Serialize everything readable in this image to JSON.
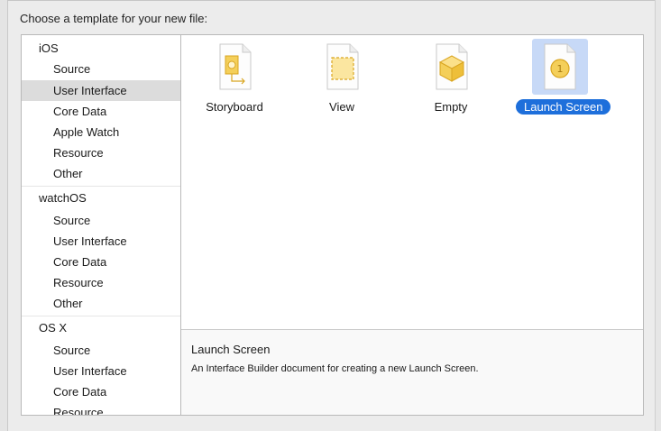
{
  "dialog": {
    "header": "Choose a template for your new file:"
  },
  "sidebar": {
    "items": [
      {
        "label": "iOS",
        "kind": "category"
      },
      {
        "label": "Source",
        "kind": "sub"
      },
      {
        "label": "User Interface",
        "kind": "sub",
        "selected": true
      },
      {
        "label": "Core Data",
        "kind": "sub"
      },
      {
        "label": "Apple Watch",
        "kind": "sub"
      },
      {
        "label": "Resource",
        "kind": "sub"
      },
      {
        "label": "Other",
        "kind": "sub"
      },
      {
        "label": "watchOS",
        "kind": "category"
      },
      {
        "label": "Source",
        "kind": "sub"
      },
      {
        "label": "User Interface",
        "kind": "sub"
      },
      {
        "label": "Core Data",
        "kind": "sub"
      },
      {
        "label": "Resource",
        "kind": "sub"
      },
      {
        "label": "Other",
        "kind": "sub"
      },
      {
        "label": "OS X",
        "kind": "category"
      },
      {
        "label": "Source",
        "kind": "sub"
      },
      {
        "label": "User Interface",
        "kind": "sub"
      },
      {
        "label": "Core Data",
        "kind": "sub"
      },
      {
        "label": "Resource",
        "kind": "sub"
      }
    ]
  },
  "templates": [
    {
      "label": "Storyboard",
      "icon": "storyboard-file-icon"
    },
    {
      "label": "View",
      "icon": "view-file-icon"
    },
    {
      "label": "Empty",
      "icon": "empty-file-icon"
    },
    {
      "label": "Launch Screen",
      "icon": "launch-screen-file-icon",
      "selected": true
    }
  ],
  "description": {
    "title": "Launch Screen",
    "text": "An Interface Builder document for creating a new Launch Screen."
  },
  "colors": {
    "selection_blue": "#1e6fdb",
    "selection_tile": "#c7d9f7",
    "sidebar_selected": "#dcdcdc",
    "icon_gold": "#f2c94c"
  }
}
